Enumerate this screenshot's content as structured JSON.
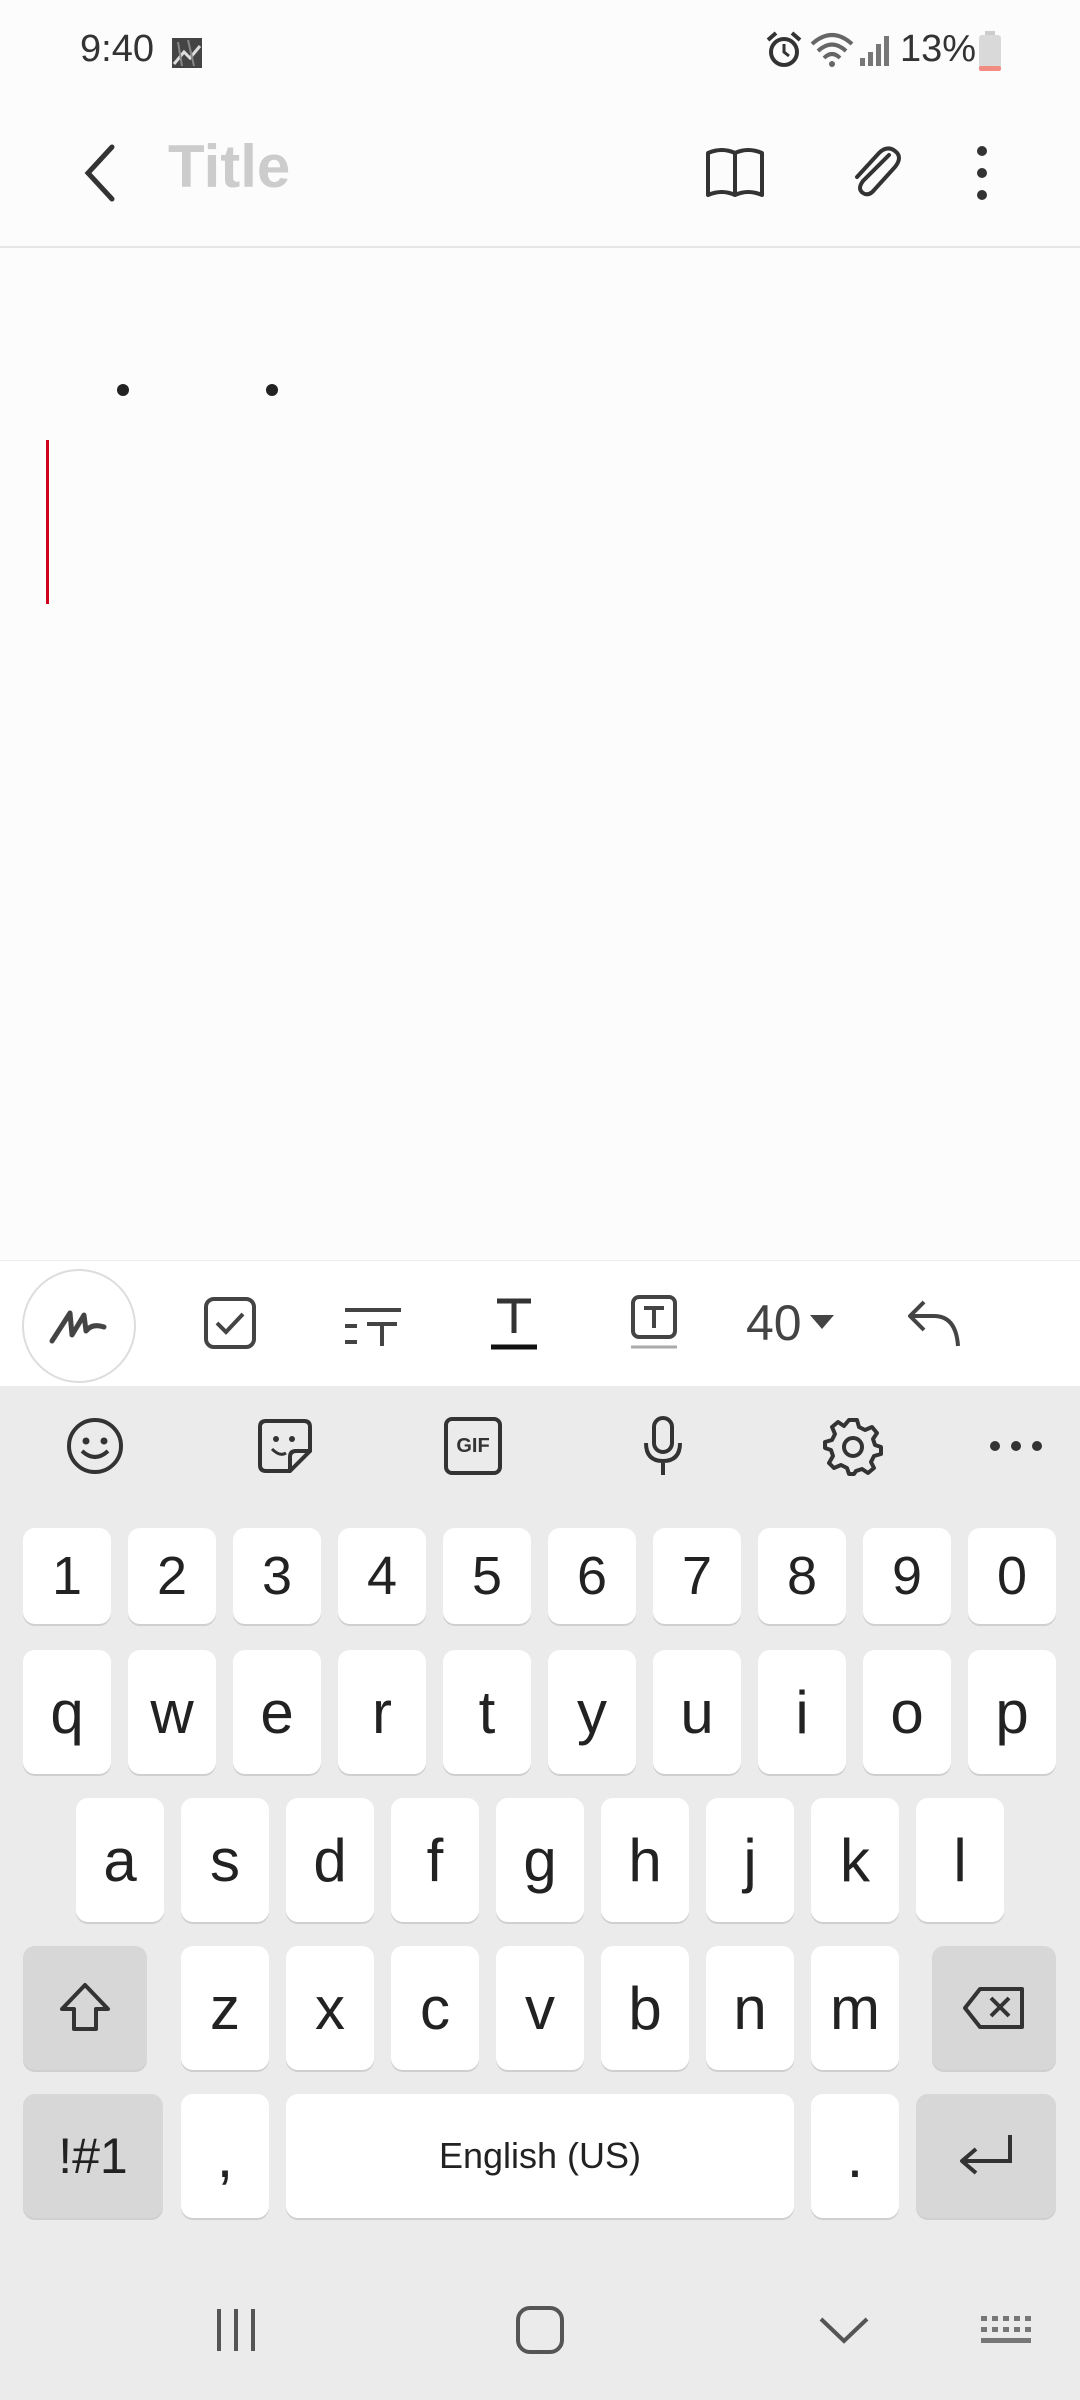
{
  "status_bar": {
    "time": "9:40",
    "battery_percent": "13%",
    "battery_level": 0.13
  },
  "app_bar": {
    "title_placeholder": "Title",
    "title_value": ""
  },
  "note": {
    "bullets": 2
  },
  "toolbar": {
    "font_size": "40"
  },
  "keyboard": {
    "number_row": [
      "1",
      "2",
      "3",
      "4",
      "5",
      "6",
      "7",
      "8",
      "9",
      "0"
    ],
    "row1": [
      "q",
      "w",
      "e",
      "r",
      "t",
      "y",
      "u",
      "i",
      "o",
      "p"
    ],
    "row2": [
      "a",
      "s",
      "d",
      "f",
      "g",
      "h",
      "j",
      "k",
      "l"
    ],
    "row3": [
      "z",
      "x",
      "c",
      "v",
      "b",
      "n",
      "m"
    ],
    "symbols_label": "!#1",
    "comma": ",",
    "space_label": "English (US)",
    "period": ".",
    "gif_label": "GIF"
  },
  "colors": {
    "caret": "#d0021b",
    "battery_low": "#f28b82",
    "keyboard_bg": "#ebebeb"
  }
}
